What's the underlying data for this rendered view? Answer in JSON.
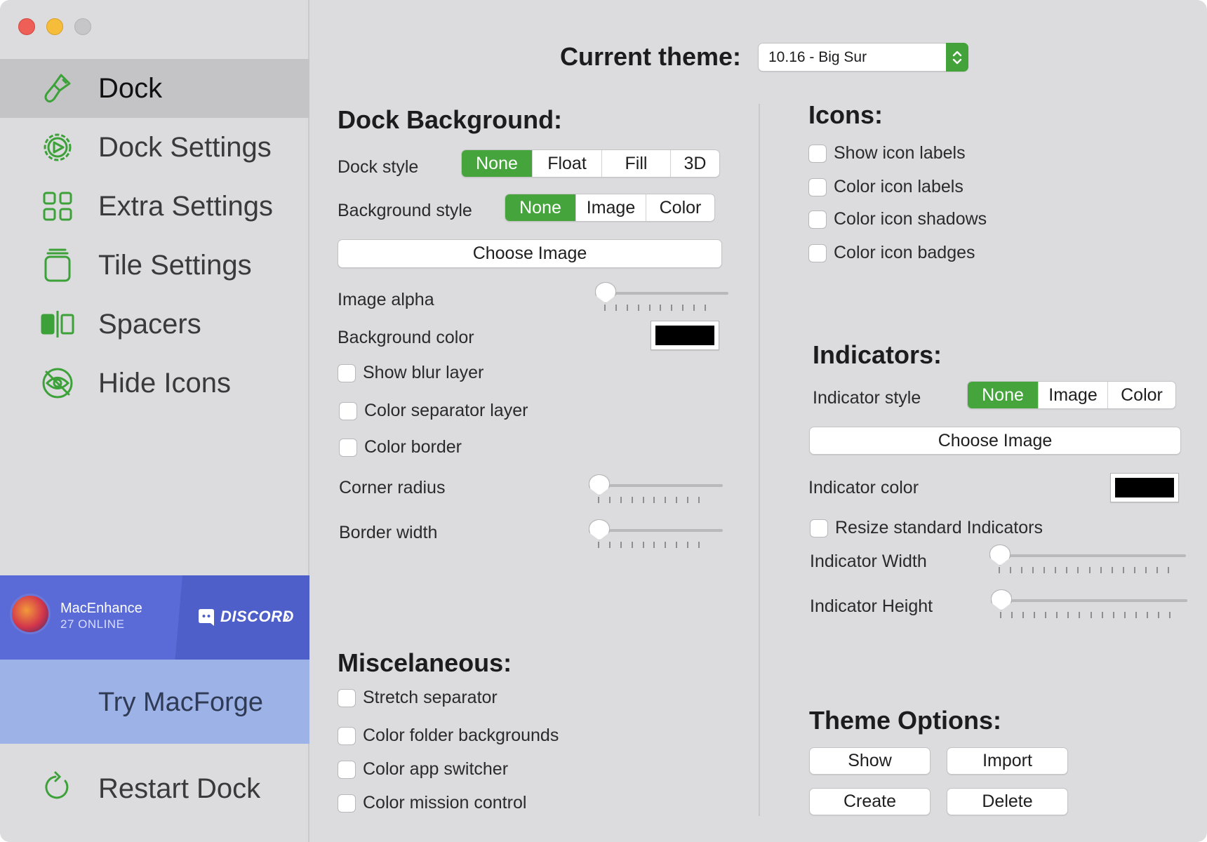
{
  "sidebar": {
    "items": [
      {
        "label": "Dock",
        "icon": "paintbrush-icon"
      },
      {
        "label": "Dock Settings",
        "icon": "dock-settings-gear-icon"
      },
      {
        "label": "Extra Settings",
        "icon": "grid-icon"
      },
      {
        "label": "Tile Settings",
        "icon": "tile-icon"
      },
      {
        "label": "Spacers",
        "icon": "spacers-icon"
      },
      {
        "label": "Hide Icons",
        "icon": "hide-eye-icon"
      }
    ],
    "discord": {
      "name": "MacEnhance",
      "online": "27 ONLINE",
      "brand": "DISCORD"
    },
    "try_macforge": "Try MacForge",
    "restart": "Restart Dock"
  },
  "header": {
    "label": "Current theme:",
    "theme_value": "10.16 - Big Sur"
  },
  "dock_background": {
    "title": "Dock Background:",
    "dock_style_label": "Dock style",
    "dock_style_options": [
      "None",
      "Float",
      "Fill",
      "3D"
    ],
    "dock_style_selected": "None",
    "background_style_label": "Background style",
    "background_style_options": [
      "None",
      "Image",
      "Color"
    ],
    "background_style_selected": "None",
    "choose_image": "Choose Image",
    "image_alpha_label": "Image alpha",
    "image_alpha_value": 0,
    "background_color_label": "Background color",
    "background_color": "#000000",
    "show_blur_layer": "Show blur layer",
    "color_separator_layer": "Color separator layer",
    "color_border": "Color border",
    "corner_radius_label": "Corner radius",
    "corner_radius_value": 0,
    "border_width_label": "Border width",
    "border_width_value": 0
  },
  "misc": {
    "title": "Miscelaneous:",
    "stretch_separator": "Stretch separator",
    "color_folder_backgrounds": "Color folder backgrounds",
    "color_app_switcher": "Color app switcher",
    "color_mission_control": "Color mission control"
  },
  "icons": {
    "title": "Icons:",
    "show_icon_labels": "Show icon labels",
    "color_icon_labels": "Color icon labels",
    "color_icon_shadows": "Color icon shadows",
    "color_icon_badges": "Color icon badges"
  },
  "indicators": {
    "title": "Indicators:",
    "style_label": "Indicator style",
    "style_options": [
      "None",
      "Image",
      "Color"
    ],
    "style_selected": "None",
    "choose_image": "Choose Image",
    "color_label": "Indicator color",
    "color": "#000000",
    "resize": "Resize standard Indicators",
    "width_label": "Indicator Width",
    "width_value": 0,
    "height_label": "Indicator Height",
    "height_value": 0
  },
  "theme_options": {
    "title": "Theme Options:",
    "show": "Show",
    "import": "Import",
    "create": "Create",
    "delete": "Delete"
  },
  "colors": {
    "accent": "#45a53c",
    "discord": "#5a6bd8",
    "macforge": "#9db2e6"
  }
}
